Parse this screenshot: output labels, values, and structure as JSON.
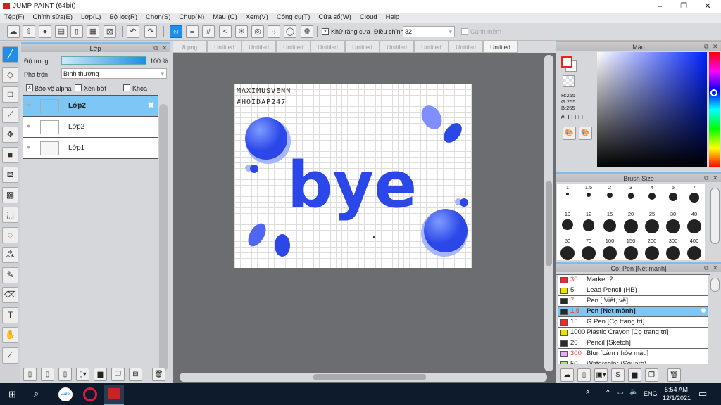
{
  "app": {
    "title": "JUMP PAINT (64bit)"
  },
  "menu": [
    "Tệp(F)",
    "Chỉnh sửa(E)",
    "Lớp(L)",
    "Bộ lọc(R)",
    "Chọn(S)",
    "Chụp(N)",
    "Màu (C)",
    "Xem(V)",
    "Công cụ(T)",
    "Cửa sổ(W)",
    "Cloud",
    "Help"
  ],
  "toolbar": {
    "antialias_label": "Khử răng cưa",
    "adjust_label": "Điều chỉnh",
    "adjust_value": "32",
    "smooth_label": "Cạnh mềm"
  },
  "layer_panel": {
    "title": "Lớp",
    "opacity_label": "Độ trong",
    "opacity_value": "100 %",
    "opacity_fraction": 1.0,
    "blend_label": "Pha trộn",
    "blend_value": "Bình thường",
    "protect_alpha": "Bảo vệ alpha",
    "clipping": "Xén bớt",
    "lock": "Khóa",
    "layers": [
      {
        "name": "Lớp2"
      },
      {
        "name": "Lớp2"
      },
      {
        "name": "Lớp1"
      }
    ]
  },
  "tabs": [
    "8.png",
    "Untitled",
    "Untitled",
    "Untitled",
    "Untitled",
    "Untitled",
    "Untitled",
    "Untitled",
    "Untitled",
    "Untitled"
  ],
  "canvas": {
    "line1": "MAXIMUSVENN",
    "line2": "#HOIDAP247",
    "art_word": "bye"
  },
  "color_panel": {
    "title": "Màu",
    "r": "R:255",
    "g": "G:255",
    "b": "B:255",
    "hex": "#FFFFFF",
    "accent": "#3f5ef0"
  },
  "brush_size": {
    "title": "Brush Size",
    "sizes": [
      "1",
      "1.5",
      "2",
      "3",
      "4",
      "5",
      "7",
      "10",
      "12",
      "15",
      "20",
      "25",
      "30",
      "40",
      "50",
      "70",
      "100",
      "150",
      "200",
      "300",
      "400"
    ]
  },
  "brush_list": {
    "title": "Cọ: Pen [Nét mảnh]",
    "items": [
      {
        "size": "30",
        "name": "Marker 2",
        "color": "#ee2b2b",
        "red": true
      },
      {
        "size": "5",
        "name": "Lead Pencil (HB)",
        "color": "#f0e000",
        "red": false
      },
      {
        "size": "7",
        "name": "Pen [ Viết, vẽ]",
        "color": "#2a2a2a",
        "red": true
      },
      {
        "size": "1.5",
        "name": "Pen [Nét mảnh]",
        "color": "#2a2a2a",
        "red": true,
        "selected": true
      },
      {
        "size": "15",
        "name": "G Pen [Cọ trang trí]",
        "color": "#ee2b2b",
        "red": false
      },
      {
        "size": "1000",
        "name": "Plastic Crayon [Cọ trang trí]",
        "color": "#f0e000",
        "red": false
      },
      {
        "size": "20",
        "name": "Pencil [Sketch]",
        "color": "#2a2a2a",
        "red": false
      },
      {
        "size": "300",
        "name": "Blur [Làm nhòe màu]",
        "color": "#f4a6f4",
        "red": true
      },
      {
        "size": "50",
        "name": "Watercolor (Square)",
        "color": "#b5e36a",
        "red": false
      }
    ]
  },
  "taskbar": {
    "lang": "ENG",
    "time": "5:54 AM",
    "date": "12/1/2021",
    "zalo": "Zalo"
  }
}
